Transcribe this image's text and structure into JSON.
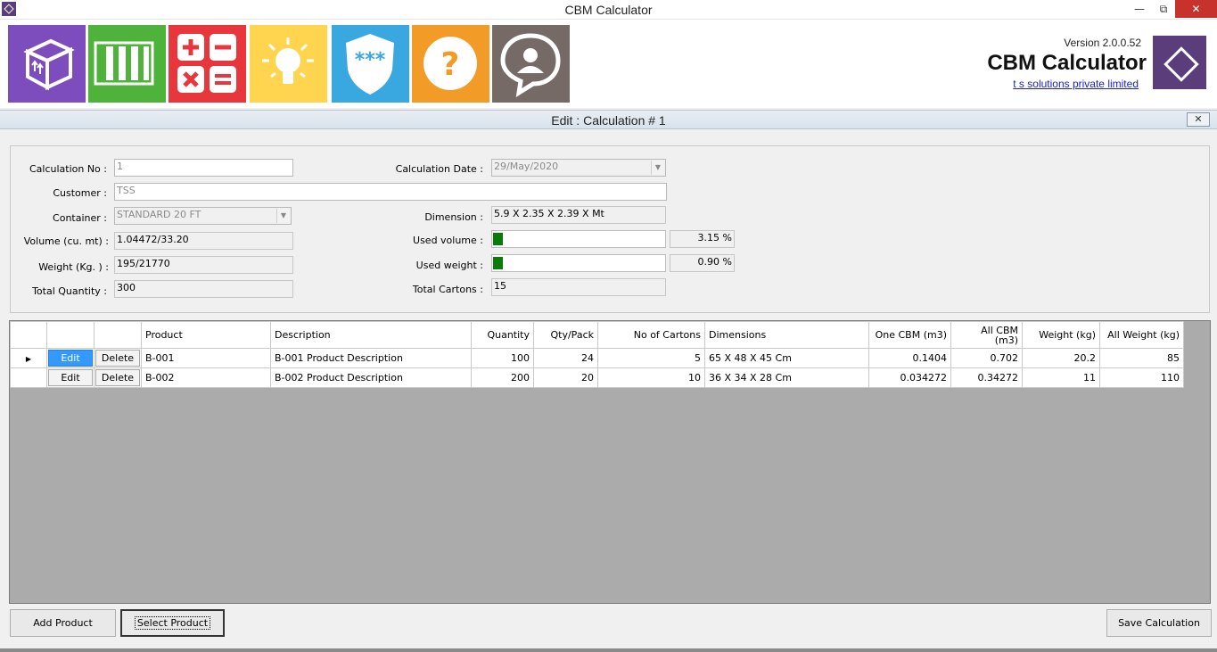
{
  "window": {
    "title": "CBM Calculator"
  },
  "header": {
    "tiles": [
      {
        "icon": "box-icon",
        "color": "#7d4dbd"
      },
      {
        "icon": "container-icon",
        "color": "#4fb33b"
      },
      {
        "icon": "calculator-icon",
        "color": "#e8373c"
      },
      {
        "icon": "lightbulb-icon",
        "color": "#ffd54f"
      },
      {
        "icon": "password-shield-icon",
        "color": "#3aa8e0"
      },
      {
        "icon": "help-icon",
        "color": "#f29b26"
      },
      {
        "icon": "support-chat-icon",
        "color": "#756a66"
      }
    ],
    "version": "Version 2.0.0.52",
    "app_name": "CBM Calculator",
    "company": "t s solutions private limited"
  },
  "form": {
    "title": "Edit : Calculation # 1",
    "fields": {
      "calc_no": {
        "label": "Calculation No :",
        "value": "1"
      },
      "calc_date": {
        "label": "Calculation Date :",
        "value": "29/May/2020"
      },
      "customer": {
        "label": "Customer :",
        "value": "TSS"
      },
      "container": {
        "label": "Container :",
        "value": "STANDARD 20 FT"
      },
      "dimension": {
        "label": "Dimension :",
        "value": "5.9 X 2.35 X 2.39 X Mt"
      },
      "volume": {
        "label": "Volume (cu. mt) :",
        "value": "1.04472/33.20"
      },
      "used_volume": {
        "label": "Used volume :",
        "percent_text": "3.15 %",
        "fraction": 0.0315
      },
      "weight": {
        "label": "Weight (Kg. ) :",
        "value": "195/21770"
      },
      "used_weight": {
        "label": "Used weight :",
        "percent_text": "0.90 %",
        "fraction": 0.009
      },
      "total_quantity": {
        "label": "Total Quantity :",
        "value": "300"
      },
      "total_cartons": {
        "label": "Total Cartons :",
        "value": "15"
      }
    }
  },
  "grid": {
    "columns": [
      "Product",
      "Description",
      "Quantity",
      "Qty/Pack",
      "No of Cartons",
      "Dimensions",
      "One CBM (m3)",
      "All CBM (m3)",
      "Weight (kg)",
      "All Weight (kg)"
    ],
    "edit_label": "Edit",
    "delete_label": "Delete",
    "rows": [
      [
        "B-001",
        "B-001 Product Description",
        "100",
        "24",
        "5",
        "65 X 48 X 45 Cm",
        "0.1404",
        "0.702",
        "20.2",
        "85"
      ],
      [
        "B-002",
        "B-002 Product Description",
        "200",
        "20",
        "10",
        "36 X 34 X 28 Cm",
        "0.034272",
        "0.34272",
        "11",
        "110"
      ]
    ]
  },
  "buttons": {
    "add_product": "Add Product",
    "select_product": "Select Product",
    "save_calculation": "Save Calculation"
  }
}
